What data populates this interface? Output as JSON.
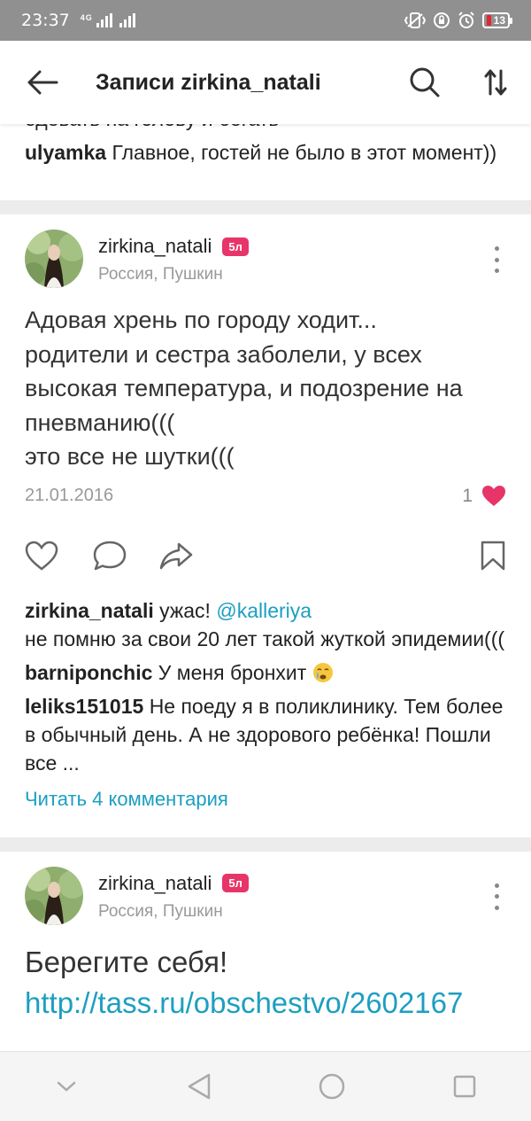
{
  "status": {
    "time": "23:37",
    "network": "4G",
    "battery": "13"
  },
  "header": {
    "title": "Записи zirkina_natali"
  },
  "previous_post": {
    "cut_text": "одевать на голову и бегать",
    "last_comment": {
      "author": "ulyamka",
      "text": "Главное, гостей не было в этот момент))"
    }
  },
  "posts": [
    {
      "username": "zirkina_natali",
      "badge": "5л",
      "location": "Россия, Пушкин",
      "text": "Адовая хрень по городу ходит...\nродители и сестра заболели, у всех высокая температура, и подозрение на пневманию(((\nэто все не шутки(((",
      "date": "21.01.2016",
      "likes": "1",
      "comments": [
        {
          "author": "zirkina_natali",
          "pre": "ужас!",
          "mention": "@kalleriya",
          "text": "не помню за свои 20 лет такой жуткой эпидемии((("
        },
        {
          "author": "barniponchic",
          "text": "У меня бронхит"
        },
        {
          "author": "leliks151015",
          "text": "Не поеду я в поликлинику. Тем более в обычный день. А не здорового ребёнка! Пошли все ..."
        }
      ],
      "read_more": "Читать 4 комментария"
    },
    {
      "username": "zirkina_natali",
      "badge": "5л",
      "location": "Россия, Пушкин",
      "text": "Берегите себя!",
      "link": "http://tass.ru/obschestvo/2602167"
    }
  ],
  "colors": {
    "accent": "#1c9fc0",
    "like": "#e73569",
    "separator": "#ececec"
  }
}
